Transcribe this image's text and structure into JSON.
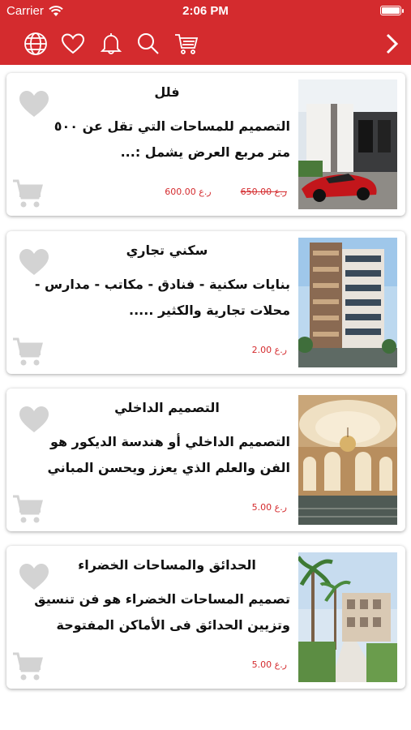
{
  "status_bar": {
    "carrier": "Carrier",
    "time": "2:06 PM"
  },
  "toolbar": {
    "icons": [
      "globe-icon",
      "heart-icon",
      "bell-icon",
      "search-icon",
      "cart-icon",
      "chevron-right-icon"
    ]
  },
  "colors": {
    "brand_red": "#d42b2e",
    "icon_gray": "#d3d3d3",
    "text": "#111111"
  },
  "products": [
    {
      "title": "فلل",
      "description": "التصميم للمساحات التي تقل عن ٥٠٠ متر مربع العرض يشمل :...",
      "price": "600.00 ر.ع",
      "old_price": "650.00 ر.ع",
      "image": "villa-photo"
    },
    {
      "title": "سكني تجاري",
      "description": "بنايات سكنية - فنادق - مكاتب - مدارس - محلات تجارية والكثير .....",
      "price": "2.00 ر.ع",
      "old_price": "",
      "image": "residential-building-photo"
    },
    {
      "title": "التصميم الداخلي",
      "description": "التصميم الداخلي أو هندسة الديكور هو الفن والعلم الذي يعزز ويحسن المباني من الداخل...",
      "price": "5.00 ر.ع",
      "old_price": "",
      "image": "interior-hall-photo"
    },
    {
      "title": "الحدائق والمساحات الخضراء",
      "description": "تصميم المساحات الخضراء هو فن تنسيق وتزيين الحدائق فى الأماكن المفتوحة واست...",
      "price": "5.00 ر.ع",
      "old_price": "",
      "image": "garden-photo"
    }
  ]
}
